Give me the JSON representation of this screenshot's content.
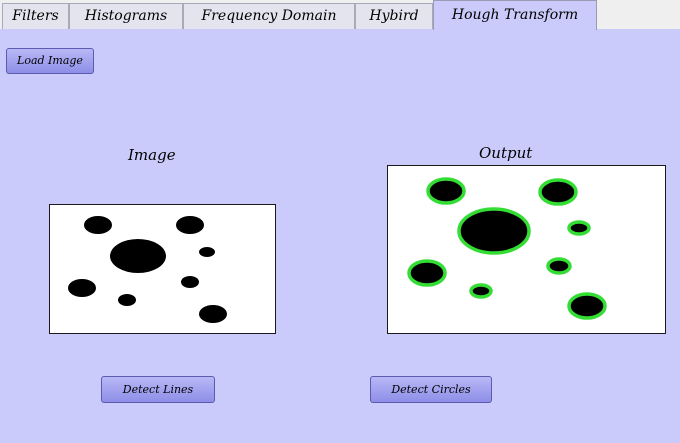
{
  "tabs": [
    {
      "label": "Filters",
      "active": false
    },
    {
      "label": "Histograms",
      "active": false
    },
    {
      "label": "Frequency Domain",
      "active": false
    },
    {
      "label": "Hybird",
      "active": false
    },
    {
      "label": "Hough Transform",
      "active": true
    }
  ],
  "load_button_label": "Load Image",
  "image_panel": {
    "title": "Image"
  },
  "output_panel": {
    "title": "Output"
  },
  "detect_lines_label": "Detect Lines",
  "detect_circles_label": "Detect Circles",
  "colors": {
    "background": "#cbcbfb",
    "circle_fill": "#000000",
    "detected_outline": "#33dd33"
  }
}
